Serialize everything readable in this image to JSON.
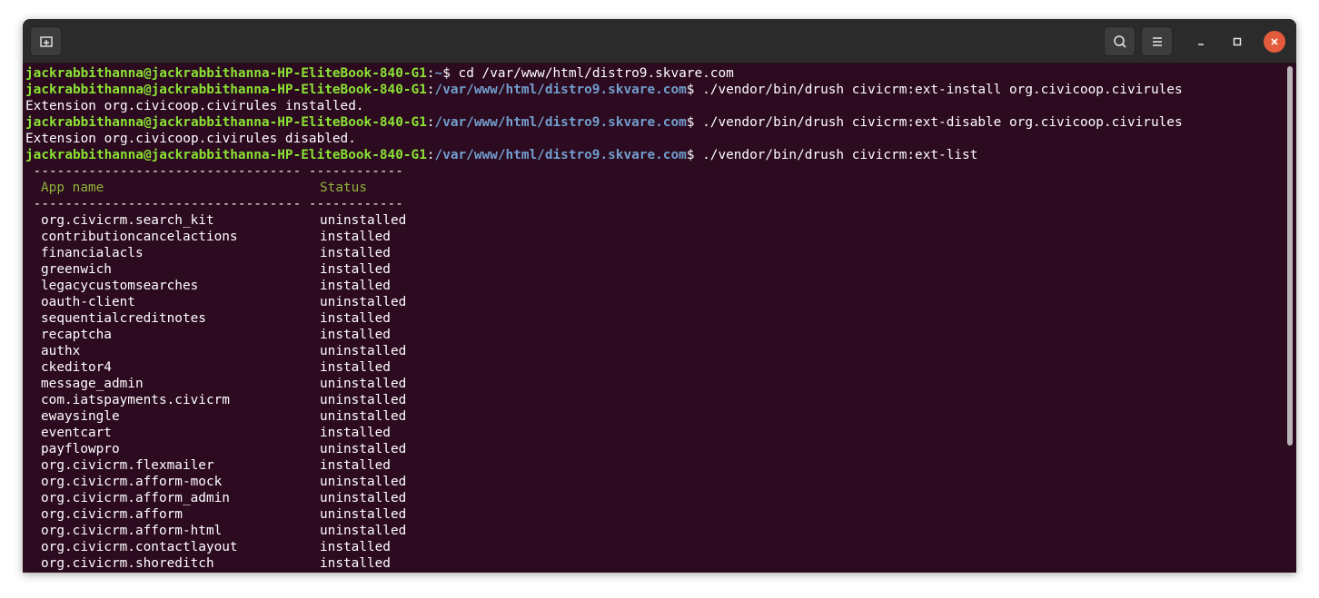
{
  "window": {
    "new_tab_icon": "new-tab-icon",
    "search_icon": "search-icon",
    "menu_icon": "hamburger-menu-icon",
    "minimize_icon": "minimize-icon",
    "maximize_icon": "maximize-icon",
    "close_icon": "close-icon"
  },
  "colors": {
    "terminal_bg": "#2c0a1f",
    "user_host": "#8ae234",
    "path": "#729fcf",
    "header": "#8fb33a",
    "close": "#e45b3b"
  },
  "prompt": {
    "user_host": "jackrabbithanna@jackrabbithanna-HP-EliteBook-840-G1",
    "home": "~",
    "cwd": "/var/www/html/distro9.skvare.com"
  },
  "lines": [
    {
      "type": "cmd",
      "path": "~",
      "cmd": " cd /var/www/html/distro9.skvare.com"
    },
    {
      "type": "cmd",
      "path": "/var/www/html/distro9.skvare.com",
      "cmd": " ./vendor/bin/drush civicrm:ext-install org.civicoop.civirules"
    },
    {
      "type": "out",
      "text": "Extension org.civicoop.civirules installed."
    },
    {
      "type": "cmd",
      "path": "/var/www/html/distro9.skvare.com",
      "cmd": " ./vendor/bin/drush civicrm:ext-disable org.civicoop.civirules"
    },
    {
      "type": "out",
      "text": "Extension org.civicoop.civirules disabled."
    },
    {
      "type": "cmd",
      "path": "/var/www/html/distro9.skvare.com",
      "cmd": " ./vendor/bin/drush civicrm:ext-list"
    }
  ],
  "table": {
    "separator": " ---------------------------------- ------------",
    "headers": {
      "name": "App name",
      "status": "Status"
    },
    "rows": [
      {
        "name": "org.civicrm.search_kit",
        "status": "uninstalled"
      },
      {
        "name": "contributioncancelactions",
        "status": "installed"
      },
      {
        "name": "financialacls",
        "status": "installed"
      },
      {
        "name": "greenwich",
        "status": "installed"
      },
      {
        "name": "legacycustomsearches",
        "status": "installed"
      },
      {
        "name": "oauth-client",
        "status": "uninstalled"
      },
      {
        "name": "sequentialcreditnotes",
        "status": "installed"
      },
      {
        "name": "recaptcha",
        "status": "installed"
      },
      {
        "name": "authx",
        "status": "uninstalled"
      },
      {
        "name": "ckeditor4",
        "status": "installed"
      },
      {
        "name": "message_admin",
        "status": "uninstalled"
      },
      {
        "name": "com.iatspayments.civicrm",
        "status": "uninstalled"
      },
      {
        "name": "ewaysingle",
        "status": "uninstalled"
      },
      {
        "name": "eventcart",
        "status": "installed"
      },
      {
        "name": "payflowpro",
        "status": "uninstalled"
      },
      {
        "name": "org.civicrm.flexmailer",
        "status": "installed"
      },
      {
        "name": "org.civicrm.afform-mock",
        "status": "uninstalled"
      },
      {
        "name": "org.civicrm.afform_admin",
        "status": "uninstalled"
      },
      {
        "name": "org.civicrm.afform",
        "status": "uninstalled"
      },
      {
        "name": "org.civicrm.afform-html",
        "status": "uninstalled"
      },
      {
        "name": "org.civicrm.contactlayout",
        "status": "installed"
      },
      {
        "name": "org.civicrm.shoreditch",
        "status": "installed"
      }
    ]
  }
}
